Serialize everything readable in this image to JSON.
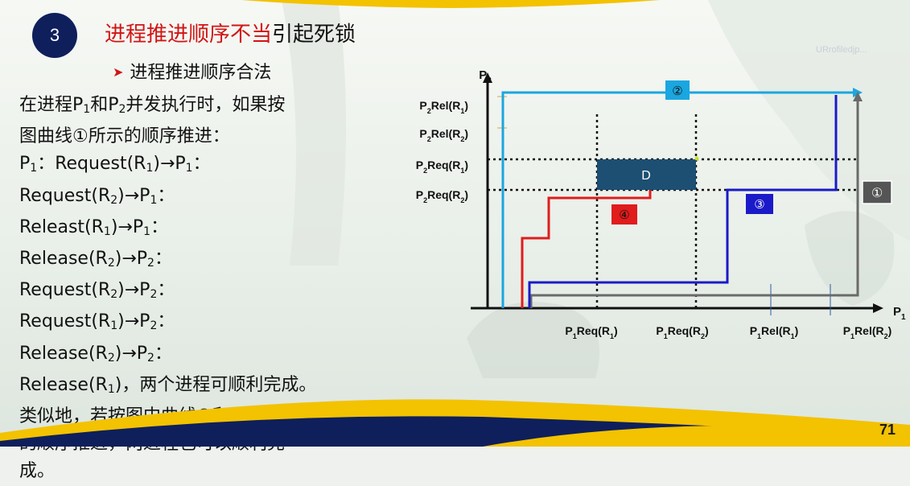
{
  "slide": {
    "number_badge": "3",
    "title_red": "进程推进顺序不当",
    "title_black": "引起死锁",
    "subtitle": "进程推进顺序合法",
    "page_number": "71",
    "watermark": "URrofiledjp..."
  },
  "body_lines": [
    {
      "parts": [
        {
          "t": "在进程P"
        },
        {
          "sub": "1"
        },
        {
          "t": "和P"
        },
        {
          "sub": "2"
        },
        {
          "t": "并发执行时，如果按"
        }
      ]
    },
    {
      "parts": [
        {
          "t": "图曲线①所示的顺序推进："
        }
      ]
    },
    {
      "parts": [
        {
          "t": "P"
        },
        {
          "sub": "1"
        },
        {
          "t": "：Request(R"
        },
        {
          "sub": "1"
        },
        {
          "t": ")→P"
        },
        {
          "sub": "1"
        },
        {
          "t": "："
        }
      ]
    },
    {
      "parts": [
        {
          "t": "Request(R"
        },
        {
          "sub": "2"
        },
        {
          "t": ")→P"
        },
        {
          "sub": "1"
        },
        {
          "t": "："
        }
      ]
    },
    {
      "parts": [
        {
          "t": "Releast(R"
        },
        {
          "sub": "1"
        },
        {
          "t": ")→P"
        },
        {
          "sub": "1"
        },
        {
          "t": "："
        }
      ]
    },
    {
      "parts": [
        {
          "t": "Release(R"
        },
        {
          "sub": "2"
        },
        {
          "t": ")→P"
        },
        {
          "sub": "2"
        },
        {
          "t": "："
        }
      ]
    },
    {
      "parts": [
        {
          "t": "Request(R"
        },
        {
          "sub": "2"
        },
        {
          "t": ")→P"
        },
        {
          "sub": "2"
        },
        {
          "t": "："
        }
      ]
    },
    {
      "parts": [
        {
          "t": "Request(R"
        },
        {
          "sub": "1"
        },
        {
          "t": ")→P"
        },
        {
          "sub": "2"
        },
        {
          "t": "："
        }
      ]
    },
    {
      "parts": [
        {
          "t": "Release(R"
        },
        {
          "sub": "2"
        },
        {
          "t": ")→P"
        },
        {
          "sub": "2"
        },
        {
          "t": "："
        }
      ]
    },
    {
      "parts": [
        {
          "t": "Release(R"
        },
        {
          "sub": "1"
        },
        {
          "t": ")，两个进程可顺利完成。"
        }
      ]
    },
    {
      "parts": [
        {
          "t": "类似地，若按图中曲线②和③所示"
        }
      ]
    },
    {
      "parts": [
        {
          "t": "的顺序推进，两进程也可以顺利完"
        }
      ]
    },
    {
      "parts": [
        {
          "t": "成。"
        }
      ]
    }
  ],
  "diagram": {
    "x_axis_label": {
      "base": "P",
      "sub": "1"
    },
    "y_axis_label": {
      "base": "P",
      "sub": "2"
    },
    "y_labels": [
      {
        "base": "P",
        "sub1": "2",
        "mid": "Rel(R",
        "sub2": "1",
        "end": ")"
      },
      {
        "base": "P",
        "sub1": "2",
        "mid": "Rel(R",
        "sub2": "2",
        "end": ")"
      },
      {
        "base": "P",
        "sub1": "2",
        "mid": "Req(R",
        "sub2": "1",
        "end": ")"
      },
      {
        "base": "P",
        "sub1": "2",
        "mid": "Req(R",
        "sub2": "2",
        "end": ")"
      }
    ],
    "x_labels": [
      {
        "base": "P",
        "sub1": "1",
        "mid": "Req(R",
        "sub2": "1",
        "end": ")"
      },
      {
        "base": "P",
        "sub1": "1",
        "mid": "Req(R",
        "sub2": "2",
        "end": ")"
      },
      {
        "base": "P",
        "sub1": "1",
        "mid": "Rel(R",
        "sub2": "1",
        "end": ")"
      },
      {
        "base": "P",
        "sub1": "1",
        "mid": "Rel(R",
        "sub2": "2",
        "end": ")"
      }
    ],
    "deadlock_region_label": "D",
    "curve_labels": {
      "curve1": "①",
      "curve2": "②",
      "curve3": "③",
      "curve4": "④"
    },
    "colors": {
      "curve1": "#6a6a6a",
      "curve2": "#1aa6e0",
      "curve3": "#1a1ac8",
      "curve4": "#e01c1c",
      "deadlock": "#1d4f73",
      "badge1_bg": "#555555",
      "badge2_bg": "#1aa6e0",
      "badge3_bg": "#1a1ac8",
      "badge4_bg": "#e01c1c"
    }
  }
}
